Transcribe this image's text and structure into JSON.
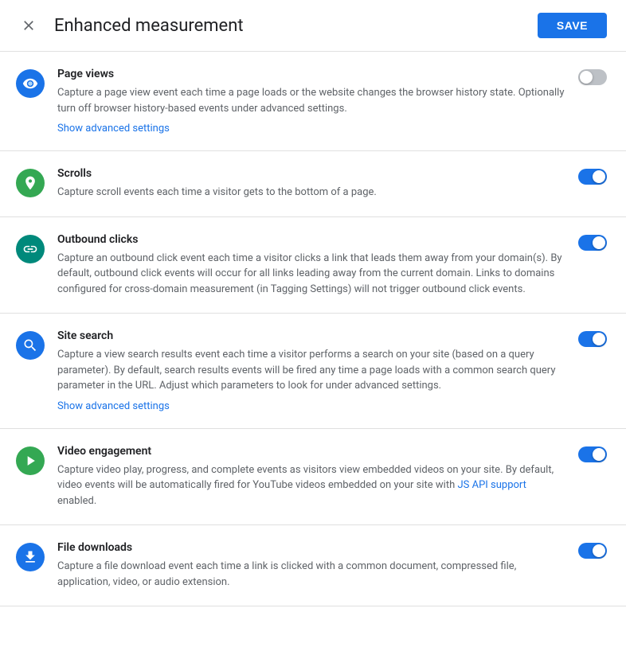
{
  "header": {
    "title": "Enhanced measurement",
    "save_label": "SAVE",
    "close_label": "×"
  },
  "settings": [
    {
      "id": "page-views",
      "icon": "eye",
      "icon_color": "icon-blue",
      "title": "Page views",
      "description": "Capture a page view event each time a page loads or the website changes the browser history state. Optionally turn off browser history-based events under advanced settings.",
      "show_advanced": true,
      "advanced_label": "Show advanced settings",
      "toggle_on": false,
      "link_text": null
    },
    {
      "id": "scrolls",
      "icon": "scroll",
      "icon_color": "icon-green",
      "title": "Scrolls",
      "description": "Capture scroll events each time a visitor gets to the bottom of a page.",
      "show_advanced": false,
      "toggle_on": true,
      "link_text": null
    },
    {
      "id": "outbound-clicks",
      "icon": "link",
      "icon_color": "icon-teal",
      "title": "Outbound clicks",
      "description": "Capture an outbound click event each time a visitor clicks a link that leads them away from your domain(s). By default, outbound click events will occur for all links leading away from the current domain. Links to domains configured for cross-domain measurement (in Tagging Settings) will not trigger outbound click events.",
      "show_advanced": false,
      "toggle_on": true,
      "link_text": null
    },
    {
      "id": "site-search",
      "icon": "search",
      "icon_color": "icon-blue-search",
      "title": "Site search",
      "description": "Capture a view search results event each time a visitor performs a search on your site (based on a query parameter). By default, search results events will be fired any time a page loads with a common search query parameter in the URL. Adjust which parameters to look for under advanced settings.",
      "show_advanced": true,
      "advanced_label": "Show advanced settings",
      "toggle_on": true,
      "link_text": null
    },
    {
      "id": "video-engagement",
      "icon": "play",
      "icon_color": "icon-green-play",
      "title": "Video engagement",
      "description_before": "Capture video play, progress, and complete events as visitors view embedded videos on your site. By default, video events will be automatically fired for YouTube videos embedded on your site with ",
      "link_text": "JS API support",
      "description_after": " enabled.",
      "show_advanced": false,
      "toggle_on": true
    },
    {
      "id": "file-downloads",
      "icon": "download",
      "icon_color": "icon-blue-download",
      "title": "File downloads",
      "description": "Capture a file download event each time a link is clicked with a common document, compressed file, application, video, or audio extension.",
      "show_advanced": false,
      "toggle_on": true,
      "link_text": null
    }
  ]
}
